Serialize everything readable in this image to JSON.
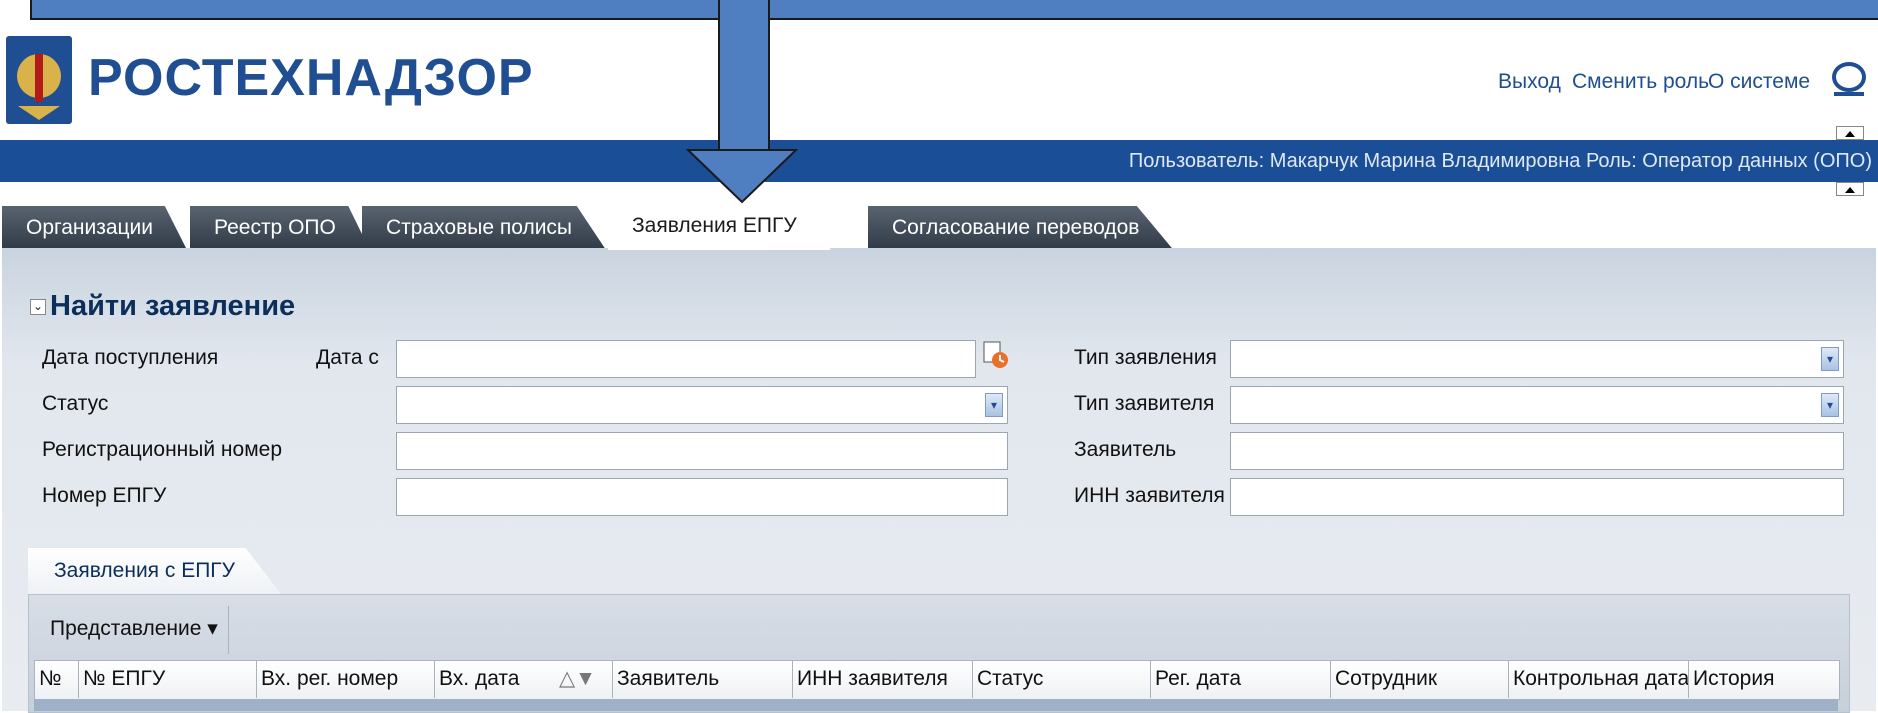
{
  "header": {
    "logo_text": "РОСТЕХНАДЗОР",
    "links": [
      "Выход",
      "Сменить роль",
      "О системе"
    ],
    "user_info": "Пользователь: Макарчук Марина Владимировна   Роль: Оператор данных (ОПО)"
  },
  "tabs": [
    {
      "label": "Организации",
      "active": false
    },
    {
      "label": "Реестр ОПО",
      "active": false
    },
    {
      "label": "Страховые полисы",
      "active": false
    },
    {
      "label": "Заявления ЕПГУ",
      "active": true
    },
    {
      "label": "Согласование переводов",
      "active": false
    }
  ],
  "search": {
    "title": "Найти заявление",
    "received_date_label": "Дата поступления",
    "date_from_label": "Дата с",
    "status_label": "Статус",
    "reg_number_label": "Регистрационный номер",
    "epgu_number_label": "Номер ЕПГУ",
    "app_type_label": "Тип заявления",
    "applicant_type_label": "Тип заявителя",
    "applicant_label": "Заявитель",
    "applicant_inn_label": "ИНН заявителя"
  },
  "results": {
    "tab_label": "Заявления с ЕПГУ",
    "view_label": "Представление ▾",
    "columns": [
      "№",
      "№ ЕПГУ",
      "Вх. рег. номер",
      "Вх. дата",
      "Заявитель",
      "ИНН заявителя",
      "Статус",
      "Рег. дата",
      "Сотрудник",
      "Контрольная дата",
      "История"
    ],
    "sort_indicator": "△▼"
  },
  "colors": {
    "brand": "#1f4e93",
    "callout": "#4f7fc0"
  }
}
